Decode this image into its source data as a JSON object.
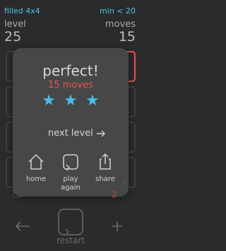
{
  "hud": {
    "left_top": "filled 4x4",
    "right_top": "min < 20",
    "left_label": "level",
    "right_label": "moves",
    "level_value": "25",
    "moves_value": "15"
  },
  "modal": {
    "title": "perfect!",
    "moves_text": "15 moves",
    "stars_count": 3,
    "next_label": "next level",
    "actions": [
      {
        "label": "home",
        "icon": "home-icon"
      },
      {
        "label": "play\nagain",
        "icon": "replay-icon"
      },
      {
        "label": "share",
        "icon": "share-icon"
      }
    ]
  },
  "bottom": {
    "restart_label": "restart",
    "left_icon": "back-arrow-icon",
    "right_icon": "plus-icon"
  },
  "colors": {
    "accent_cyan": "#3fc0ea",
    "accent_red": "#e8544e",
    "background": "#2b2b2b",
    "modal_bg": "#474747"
  }
}
